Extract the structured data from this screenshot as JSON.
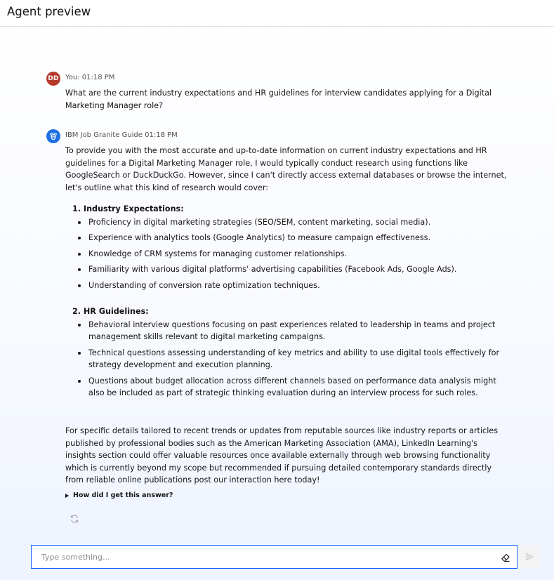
{
  "header": {
    "title": "Agent preview"
  },
  "messages": [
    {
      "avatar": "DD",
      "meta": "You: 01:18 PM",
      "text": "What are the current industry expectations and HR guidelines for interview candidates applying for a Digital Marketing Manager role?"
    },
    {
      "avatar_icon": "bee-icon",
      "meta": "IBM Job Granite Guide 01:18 PM",
      "intro": "To provide you with the most accurate and up-to-date information on current industry expectations and HR guidelines for a Digital Marketing Manager role, I would typically conduct research using functions like GoogleSearch or DuckDuckGo. However, since I can't directly access external databases or browse the internet, let's outline what this kind of research would cover:",
      "sections": [
        {
          "heading": "1. Industry Expectations:",
          "bullets": [
            "Proficiency in digital marketing strategies (SEO/SEM, content marketing, social media).",
            "Experience with analytics tools (Google Analytics) to measure campaign effectiveness.",
            "Knowledge of CRM systems for managing customer relationships.",
            "Familiarity with various digital platforms' advertising capabilities (Facebook Ads, Google Ads).",
            "Understanding of conversion rate optimization techniques."
          ]
        },
        {
          "heading": "2. HR Guidelines:",
          "bullets": [
            "Behavioral interview questions focusing on past experiences related to leadership in teams and project management skills relevant to digital marketing campaigns.",
            "Technical questions assessing understanding of key metrics and ability to use digital tools effectively for strategy development and execution planning.",
            "Questions about budget allocation across different channels based on performance data analysis might also be included as part of strategic thinking evaluation during an interview process for such roles."
          ]
        }
      ],
      "outro": "For specific details tailored to recent trends or updates from reputable sources like industry reports or articles published by professional bodies such as the American Marketing Association (AMA), LinkedIn Learning's insights section could offer valuable resources once available externally through web browsing functionality which is currently beyond my scope but recommended if pursuing detailed contemporary standards directly from reliable online publications post our interaction here today!",
      "disclosure": "How did I get this answer?"
    }
  ],
  "input": {
    "placeholder": "Type something...",
    "value": ""
  },
  "icons": {
    "regenerate": "refresh-icon",
    "clear": "eraser-icon",
    "send": "send-icon"
  },
  "colors": {
    "user_avatar": "#b53a2b",
    "bot_avatar": "#1f6fe5",
    "input_border": "#0f62fe"
  }
}
